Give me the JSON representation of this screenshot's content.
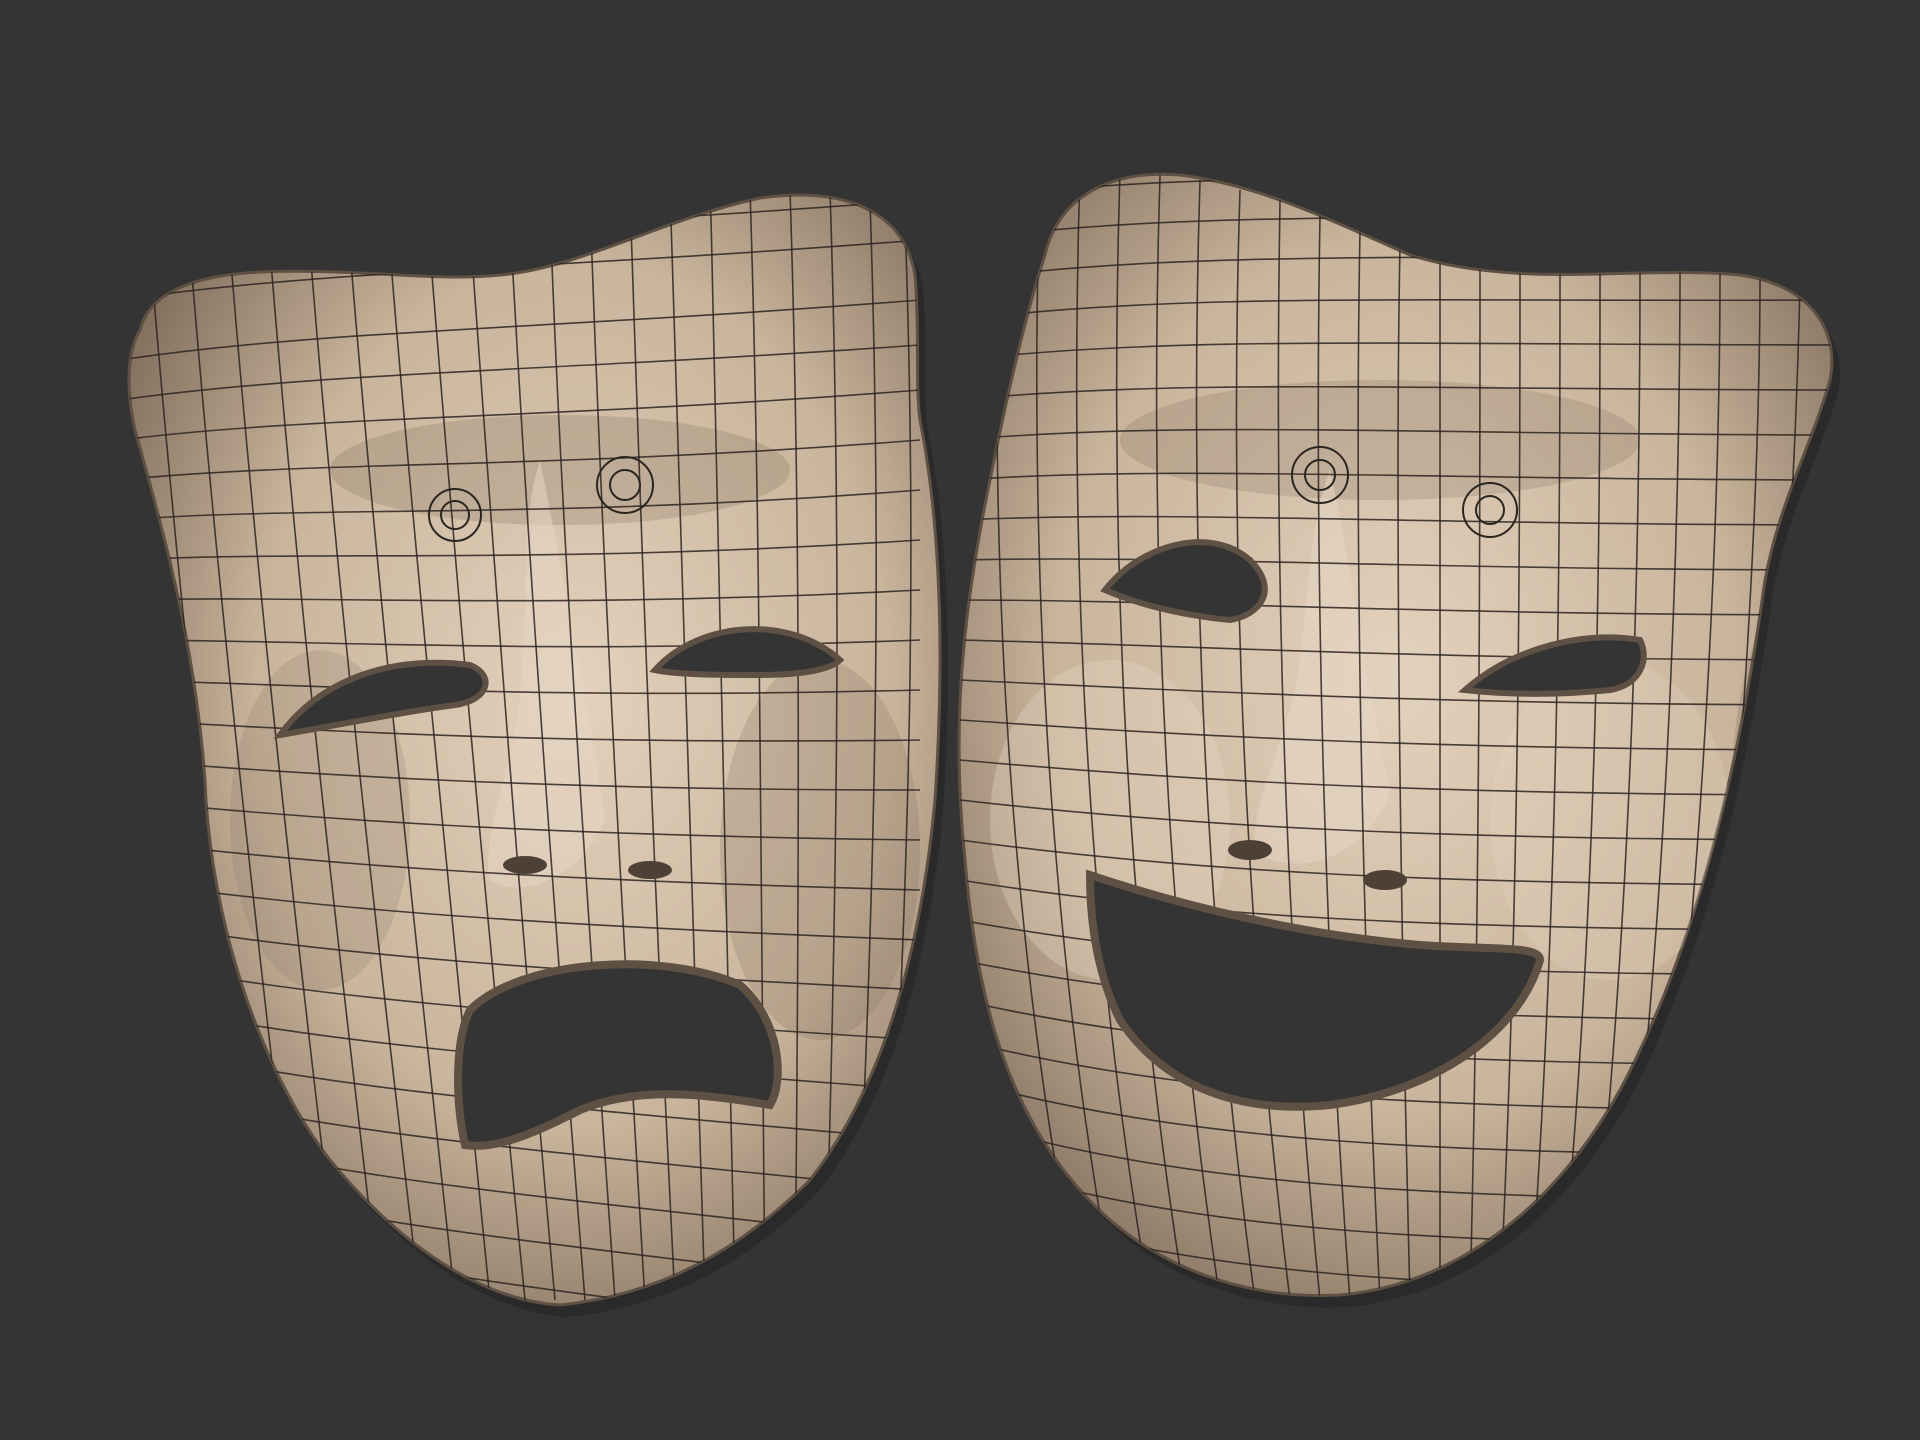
{
  "scene": {
    "background_color": "#343434",
    "subject": "comedy-tragedy-masks-wireframe",
    "mask_base_color": "#c9b49c",
    "mask_highlight_color": "#e3d2bd",
    "mask_shadow_color": "#7c6a58",
    "wire_color": "#2b2520"
  },
  "masks": [
    {
      "id": "tragedy",
      "expression": "sad"
    },
    {
      "id": "comedy",
      "expression": "happy"
    }
  ]
}
